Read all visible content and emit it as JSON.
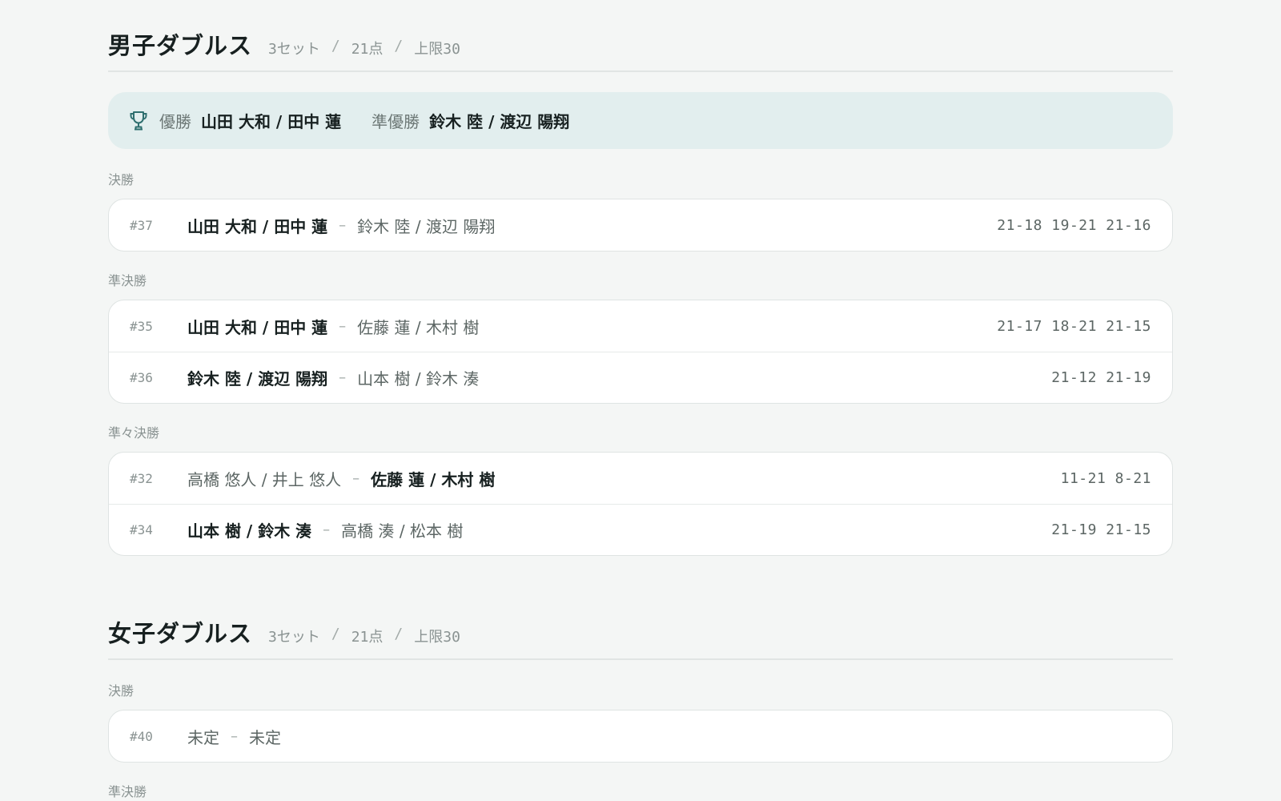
{
  "men_doubles": {
    "title": "男子ダブルス",
    "meta": {
      "sets": "3セット",
      "sep": "/",
      "points": "21点",
      "cap": "上限30"
    },
    "champion_bar": {
      "winner_label": "優勝",
      "winner_name": "山田 大和 / 田中 蓮",
      "runner_label": "準優勝",
      "runner_name": "鈴木 陸 / 渡辺 陽翔"
    },
    "rounds": [
      {
        "label": "決勝",
        "matches": [
          {
            "id": "#37",
            "team1": "山田 大和 / 田中 蓮",
            "vs": "–",
            "team2": "鈴木 陸 / 渡辺 陽翔",
            "score": "21-18 19-21 21-16",
            "winner": 1
          }
        ]
      },
      {
        "label": "準決勝",
        "matches": [
          {
            "id": "#35",
            "team1": "山田 大和 / 田中 蓮",
            "vs": "–",
            "team2": "佐藤 蓮 / 木村 樹",
            "score": "21-17 18-21 21-15",
            "winner": 1
          },
          {
            "id": "#36",
            "team1": "鈴木 陸 / 渡辺 陽翔",
            "vs": "–",
            "team2": "山本 樹 / 鈴木 湊",
            "score": "21-12 21-19",
            "winner": 1
          }
        ]
      },
      {
        "label": "準々決勝",
        "matches": [
          {
            "id": "#32",
            "team1": "高橋 悠人 / 井上 悠人",
            "vs": "–",
            "team2": "佐藤 蓮 / 木村 樹",
            "score": "11-21 8-21",
            "winner": 2
          },
          {
            "id": "#34",
            "team1": "山本 樹 / 鈴木 湊",
            "vs": "–",
            "team2": "高橋 湊 / 松本 樹",
            "score": "21-19 21-15",
            "winner": 1
          }
        ]
      }
    ]
  },
  "women_doubles": {
    "title": "女子ダブルス",
    "meta": {
      "sets": "3セット",
      "sep": "/",
      "points": "21点",
      "cap": "上限30"
    },
    "rounds": [
      {
        "label": "決勝",
        "matches": [
          {
            "id": "#40",
            "team1": "未定",
            "vs": "–",
            "team2": "未定",
            "score": "",
            "winner": 0
          }
        ]
      },
      {
        "label": "準決勝",
        "matches": []
      }
    ]
  },
  "icons": {
    "champion": "trophy-icon"
  },
  "colors": {
    "background": "#f4f6f5",
    "champion_bar": "#e2eeee",
    "trophy": "#2f6f6f",
    "card_border": "#dfe4e3",
    "text_primary": "#172020",
    "text_muted": "#8a9392"
  }
}
